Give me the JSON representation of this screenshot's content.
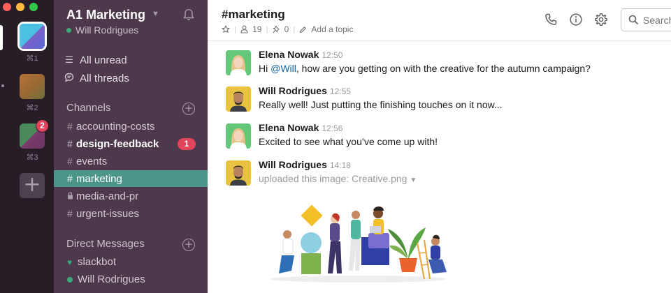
{
  "rail": {
    "workspaces": [
      {
        "shortcut": "⌘1"
      },
      {
        "shortcut": "⌘2"
      },
      {
        "shortcut": "⌘3",
        "badge": "2"
      }
    ]
  },
  "sidebar": {
    "team_name": "A1 Marketing",
    "user_name": "Will Rodrigues",
    "nav": [
      {
        "label": "All unread",
        "icon": "list-icon"
      },
      {
        "label": "All threads",
        "icon": "threads-icon"
      }
    ],
    "channels_title": "Channels",
    "channels": [
      {
        "name": "accounting-costs",
        "prefix": "#"
      },
      {
        "name": "design-feedback",
        "prefix": "#",
        "bold": true,
        "badge": "1"
      },
      {
        "name": "events",
        "prefix": "#"
      },
      {
        "name": "marketing",
        "prefix": "#",
        "active": true
      },
      {
        "name": "media-and-pr",
        "prefix": "lock"
      },
      {
        "name": "urgent-issues",
        "prefix": "#"
      }
    ],
    "dm_title": "Direct Messages",
    "dms": [
      {
        "name": "slackbot",
        "status": "heart"
      },
      {
        "name": "Will Rodrigues",
        "status": "online"
      }
    ]
  },
  "channel": {
    "title": "#marketing",
    "members": "19",
    "pins": "0",
    "add_topic": "Add a topic",
    "search_placeholder": "Search"
  },
  "messages": [
    {
      "sender": "Elena Nowak",
      "time": "12:50",
      "pre": "Hi ",
      "mention": "@Will",
      "post": ", how are you getting on with the creative for the autumn campaign?"
    },
    {
      "sender": "Will Rodrigues",
      "time": "12:55",
      "text": "Really well! Just putting the finishing touches on it now..."
    },
    {
      "sender": "Elena Nowak",
      "time": "12:56",
      "text": "Excited to see what you’ve come up with!"
    },
    {
      "sender": "Will Rodrigues",
      "time": "14:18",
      "text": "uploaded this image: Creative.png"
    }
  ],
  "colors": {
    "rail": "#261d27",
    "sidebar": "#4d394b",
    "active_channel": "#4c9689",
    "badge": "#e2445c",
    "presence": "#3daa7c",
    "mention": "#1264a3"
  }
}
